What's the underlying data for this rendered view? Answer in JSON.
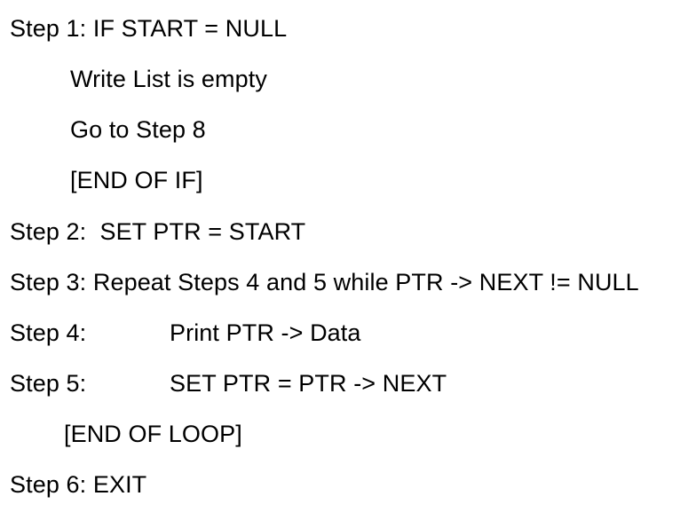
{
  "algorithm": {
    "lines": [
      "Step 1: IF START = NULL",
      "Write List is empty",
      "Go to Step 8",
      "[END OF IF]",
      "Step 2:  SET PTR = START",
      "Step 3: Repeat Steps 4 and 5 while PTR -> NEXT != NULL",
      "Step 4:",
      "Print PTR -> Data",
      "Step 5:",
      "SET PTR = PTR -> NEXT",
      "[END OF LOOP]",
      "Step 6: EXIT"
    ]
  }
}
